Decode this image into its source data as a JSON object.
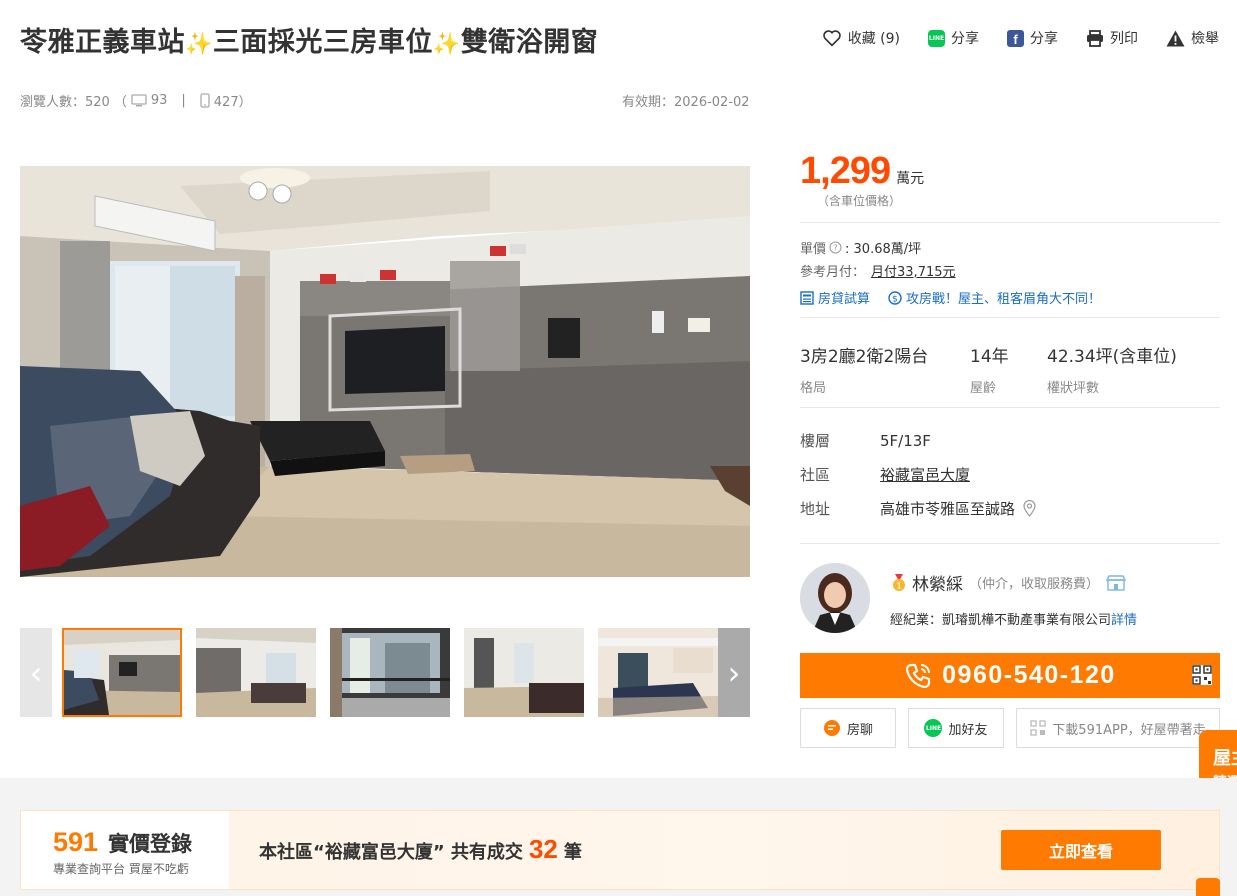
{
  "title": {
    "part1": "苓雅正義車站",
    "part2": "三面採光三房車位",
    "part3": "雙衛浴開窗",
    "sparkle": "✨"
  },
  "actions": {
    "favorite": "收藏 (9)",
    "share_line": "分享",
    "share_fb": "分享",
    "print": "列印",
    "report": "檢舉",
    "line_text": "LINE",
    "fb_text": "f"
  },
  "stats": {
    "views_label": "瀏覽人數：520",
    "open_paren": "（",
    "desktop": "93",
    "sep": "|",
    "mobile": "427）"
  },
  "expiry": "有效期：2026-02-02",
  "gallery": {
    "prev": "‹",
    "next": "›"
  },
  "price": {
    "value": "1,299",
    "unit": "萬元",
    "note": "（含車位價格）",
    "unit_price_label": "單價",
    "unit_price_value": ": 30.68萬/坪",
    "monthly_label": "參考月付：",
    "monthly_value": "月付33,715元",
    "loan_calc": "房貸試算",
    "promo": "攻房戰！屋主、租客眉角大不同！"
  },
  "specs": [
    {
      "value": "3房2廳2衛2陽台",
      "key": "格局"
    },
    {
      "value": "14年",
      "key": "屋齡"
    },
    {
      "value": "42.34坪(含車位)",
      "key": "權狀坪數"
    }
  ],
  "details": {
    "floor_label": "樓層",
    "floor_value": "5F/13F",
    "community_label": "社區",
    "community_value": "裕藏富邑大廈",
    "address_label": "地址",
    "address_value": "高雄市苓雅區至誠路"
  },
  "agent": {
    "name": "林縈綵",
    "role": "（仲介，收取服務費）",
    "company": "經紀業：凱璿凱樺不動產事業有限公司",
    "details_link": "詳情",
    "phone": "0960-540-120",
    "chat": "房聊",
    "add_friend": "加好友",
    "download": "下載591APP，好屋帶著走"
  },
  "side_tab": {
    "line1": "屋主",
    "line2": "精選"
  },
  "banner": {
    "logo_num": "591",
    "logo_text": "實價登錄",
    "logo_sub": "專業查詢平台 買屋不吃虧",
    "msg_prefix": "本社區“裕藏富邑大廈” 共有成交",
    "count": "32",
    "msg_suffix": "筆",
    "button": "立即查看"
  },
  "colors": {
    "accent": "#ff7a00",
    "price": "#ff4a00",
    "link": "#1a6ec3"
  }
}
